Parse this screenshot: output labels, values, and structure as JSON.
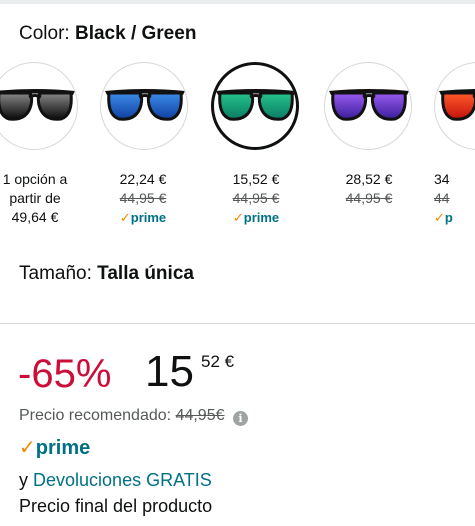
{
  "color": {
    "label": "Color:",
    "value": "Black / Green"
  },
  "swatches": [
    {
      "name": "Black / Black",
      "lens_color": "#333333",
      "lens_dark": "#0a0a0a",
      "price_lines": [
        "1 opción a",
        "partir de",
        "49,64 €"
      ],
      "list_price": "",
      "prime": "",
      "selected": false
    },
    {
      "name": "Black / Blue",
      "lens_color": "#3c8ce8",
      "lens_dark": "#0f3fa0",
      "price": "22,24 €",
      "list_price": "44,95 €",
      "prime": "prime",
      "selected": false
    },
    {
      "name": "Black / Green",
      "lens_color": "#25c48c",
      "lens_dark": "#0b7a63",
      "price": "15,52 €",
      "list_price": "44,95 €",
      "prime": "prime",
      "selected": true
    },
    {
      "name": "Black / Purple",
      "lens_color": "#7a4ce0",
      "lens_dark": "#3a1d9a",
      "price": "28,52 €",
      "list_price": "44,95 €",
      "prime": "",
      "selected": false
    },
    {
      "name": "Black / Red",
      "lens_color": "#ff4b2b",
      "lens_dark": "#c3120c",
      "price": "34",
      "list_price": "44",
      "prime": "p",
      "selected": false
    }
  ],
  "size": {
    "label": "Tamaño:",
    "value": "Talla única"
  },
  "pricing": {
    "discount": "-65%",
    "price_whole": "15",
    "price_fraction": "52 €",
    "recommended_label": "Precio recomendado:",
    "recommended_value": "44,95€",
    "info_icon": "i"
  },
  "prime": {
    "check": "✓",
    "label": "prime"
  },
  "returns": {
    "prefix": "y",
    "link": "Devoluciones GRATIS"
  },
  "final_price_label": "Precio final del producto",
  "colors": {
    "link": "#007185",
    "discount": "#cc0c39",
    "prime_check": "#f08804"
  }
}
